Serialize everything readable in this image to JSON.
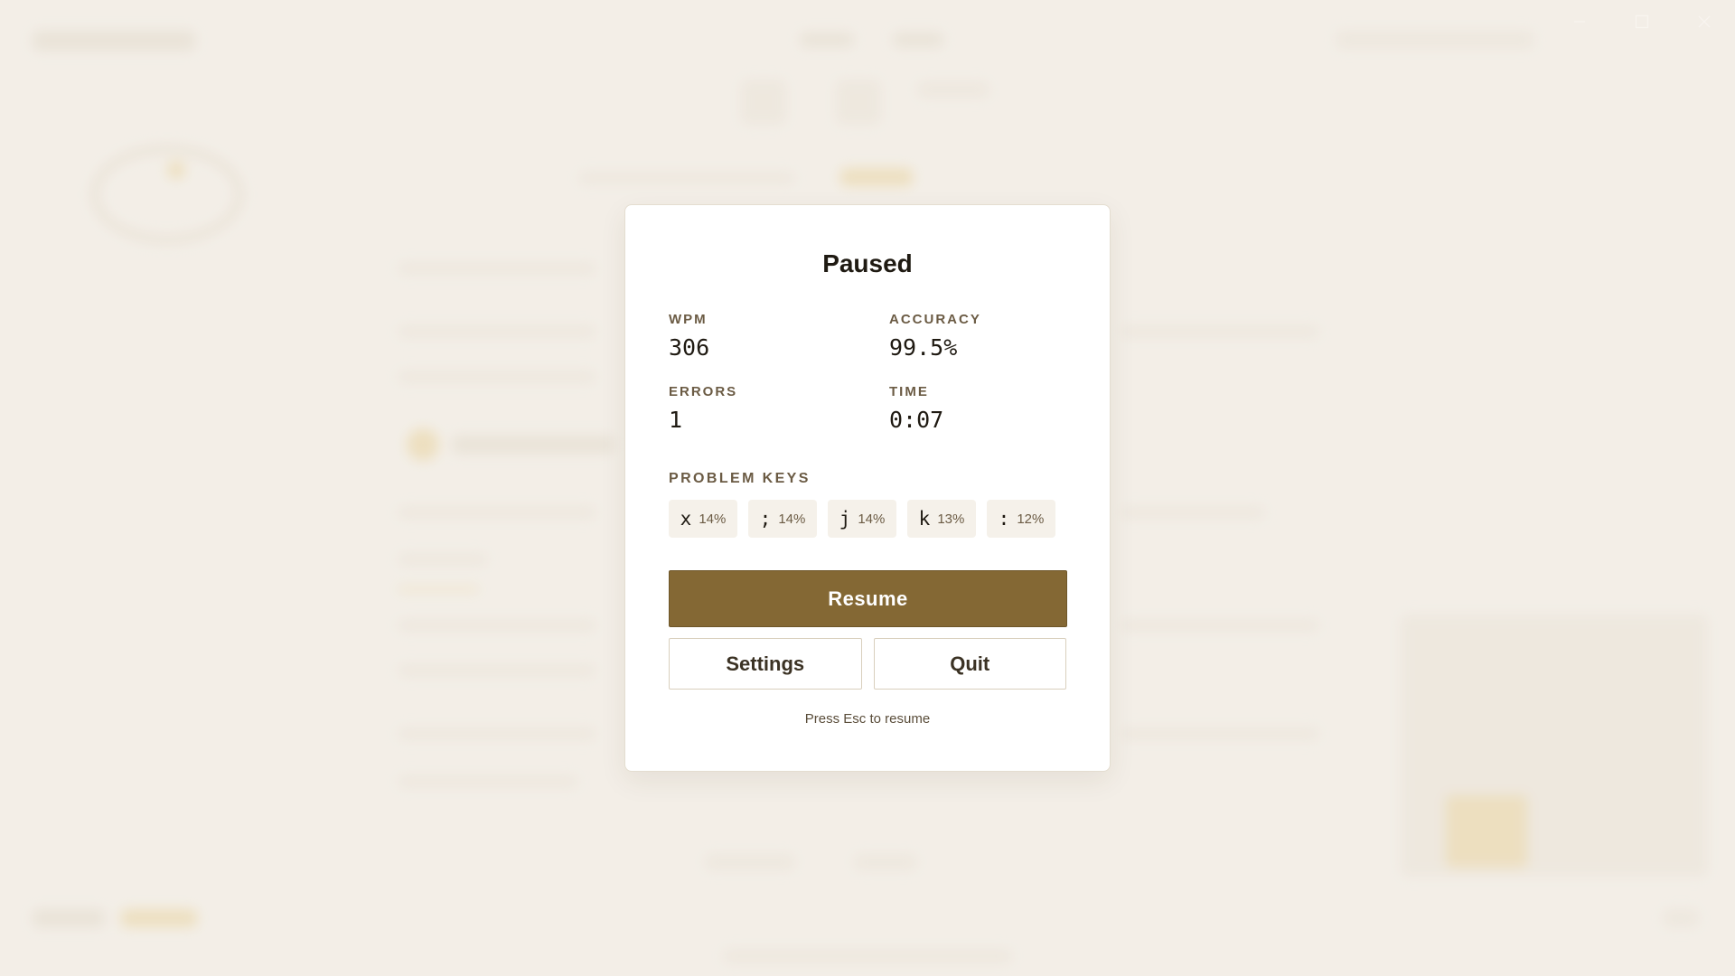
{
  "modal": {
    "title": "Paused",
    "stats": {
      "wpm": {
        "label": "WPM",
        "value": "306"
      },
      "accuracy": {
        "label": "ACCURACY",
        "value": "99.5%"
      },
      "errors": {
        "label": "ERRORS",
        "value": "1"
      },
      "time": {
        "label": "TIME",
        "value": "0:07"
      }
    },
    "problem_keys_label": "PROBLEM KEYS",
    "problem_keys": [
      {
        "key": "x",
        "pct": "14%"
      },
      {
        "key": ";",
        "pct": "14%"
      },
      {
        "key": "j",
        "pct": "14%"
      },
      {
        "key": "k",
        "pct": "13%"
      },
      {
        "key": ":",
        "pct": "12%"
      }
    ],
    "resume_label": "Resume",
    "settings_label": "Settings",
    "quit_label": "Quit",
    "hint": "Press Esc to resume"
  },
  "colors": {
    "background": "#f3efe7",
    "accent": "#846834",
    "label": "#6b5b44"
  },
  "window_controls": [
    "minimize-icon",
    "maximize-icon",
    "close-icon"
  ]
}
